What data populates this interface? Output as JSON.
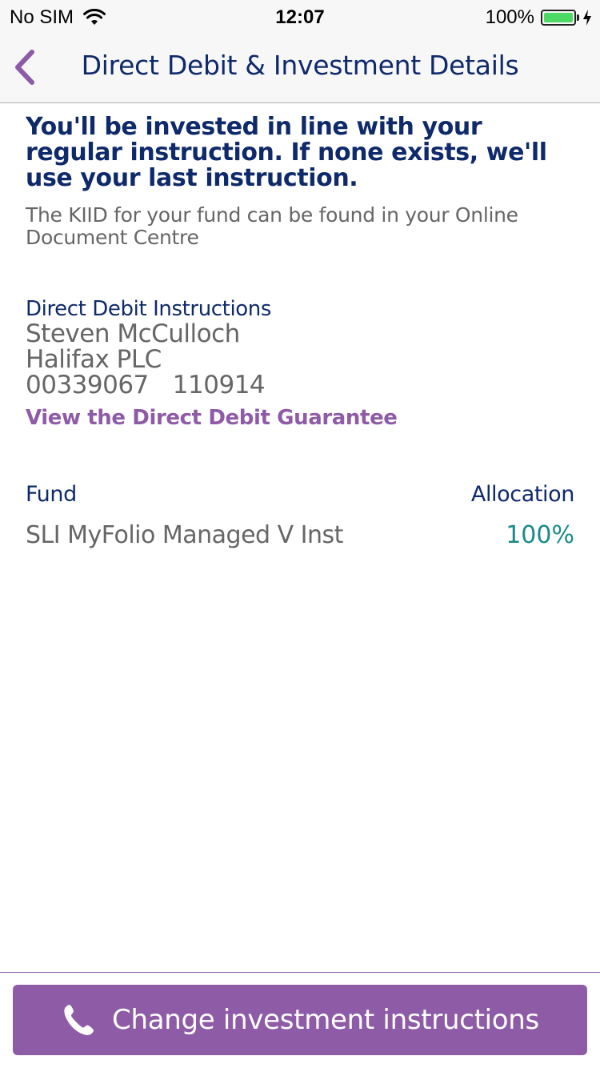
{
  "status_bar": {
    "carrier": "No SIM",
    "time": "12:07",
    "battery": "100%",
    "wifi_icon": "wifi-icon",
    "battery_icon": "battery-icon",
    "charging_icon": "charging-bolt-icon"
  },
  "nav": {
    "title": "Direct Debit & Investment Details",
    "back_icon": "chevron-left-icon"
  },
  "intro": {
    "heading": "You'll be invested in line with your regular instruction. If none exists, we'll use your last instruction.",
    "kiid_note": "The KIID for your fund can be found in your Online Document Centre"
  },
  "direct_debit": {
    "heading": "Direct Debit Instructions",
    "account_name": "Steven McCulloch",
    "bank": "Halifax PLC",
    "account_number": "00339067",
    "sort_code": "110914",
    "guarantee_link": "View the Direct Debit Guarantee"
  },
  "funds": {
    "column_fund": "Fund",
    "column_allocation": "Allocation",
    "rows": [
      {
        "name": "SLI MyFolio Managed V Inst",
        "allocation": "100%"
      }
    ]
  },
  "action": {
    "label": "Change investment instructions",
    "icon": "phone-icon"
  },
  "colors": {
    "navy": "#0f2a6b",
    "purple": "#8e5ba6",
    "gray_text": "#666666",
    "teal": "#1a8a8a"
  }
}
